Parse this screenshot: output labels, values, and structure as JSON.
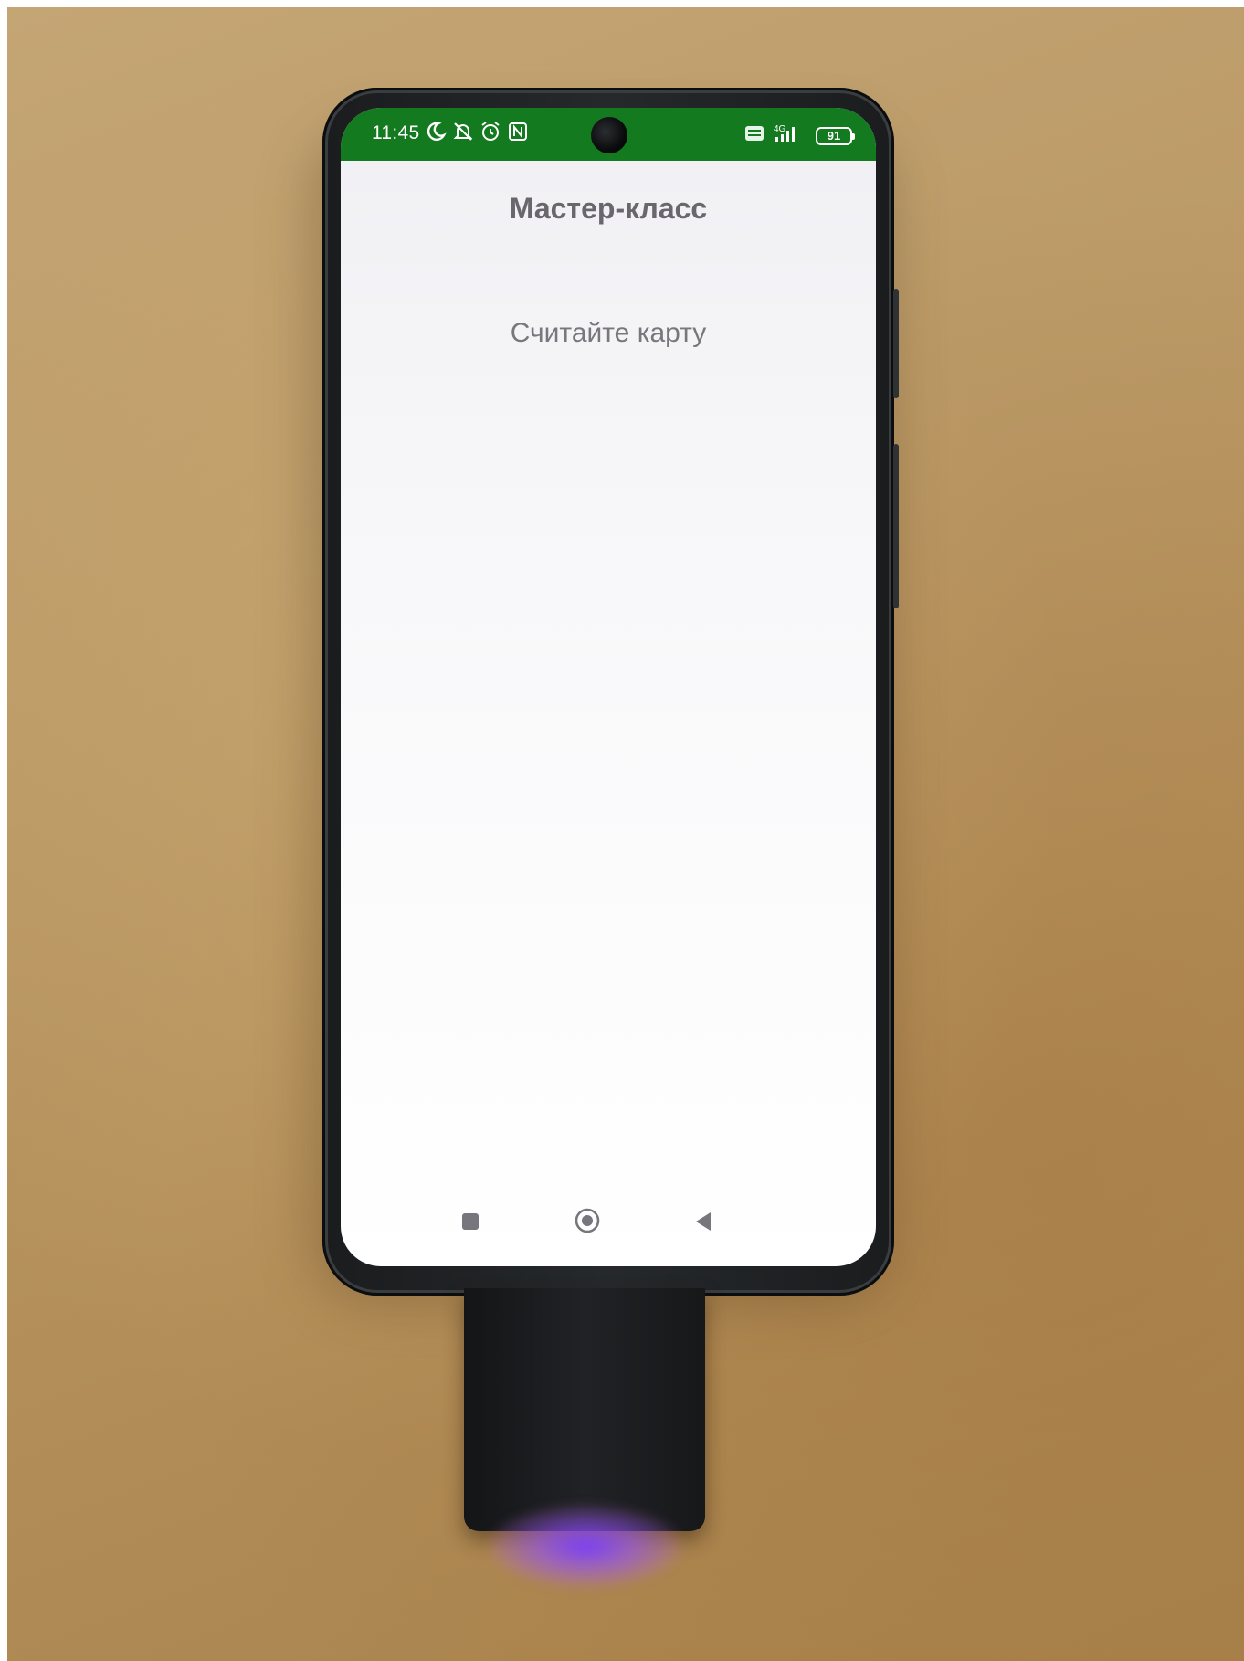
{
  "status_bar": {
    "time": "11:45",
    "battery_level": "91",
    "network": "4G",
    "background_color": "#137a1f",
    "left_icons": [
      "moon-icon",
      "notifications-off-icon",
      "alarm-icon",
      "nfc-icon"
    ],
    "right_icons": [
      "volte-icon",
      "signal-icon",
      "battery-icon"
    ]
  },
  "screen": {
    "title": "Мастер-класс",
    "prompt": "Считайте карту"
  },
  "nav_bar": {
    "icons": [
      "recent-apps-icon",
      "home-icon",
      "back-icon"
    ]
  },
  "colors": {
    "wall": "#bb9a67",
    "phone_body": "#1f2124",
    "reader_led": "#7a3cff"
  }
}
